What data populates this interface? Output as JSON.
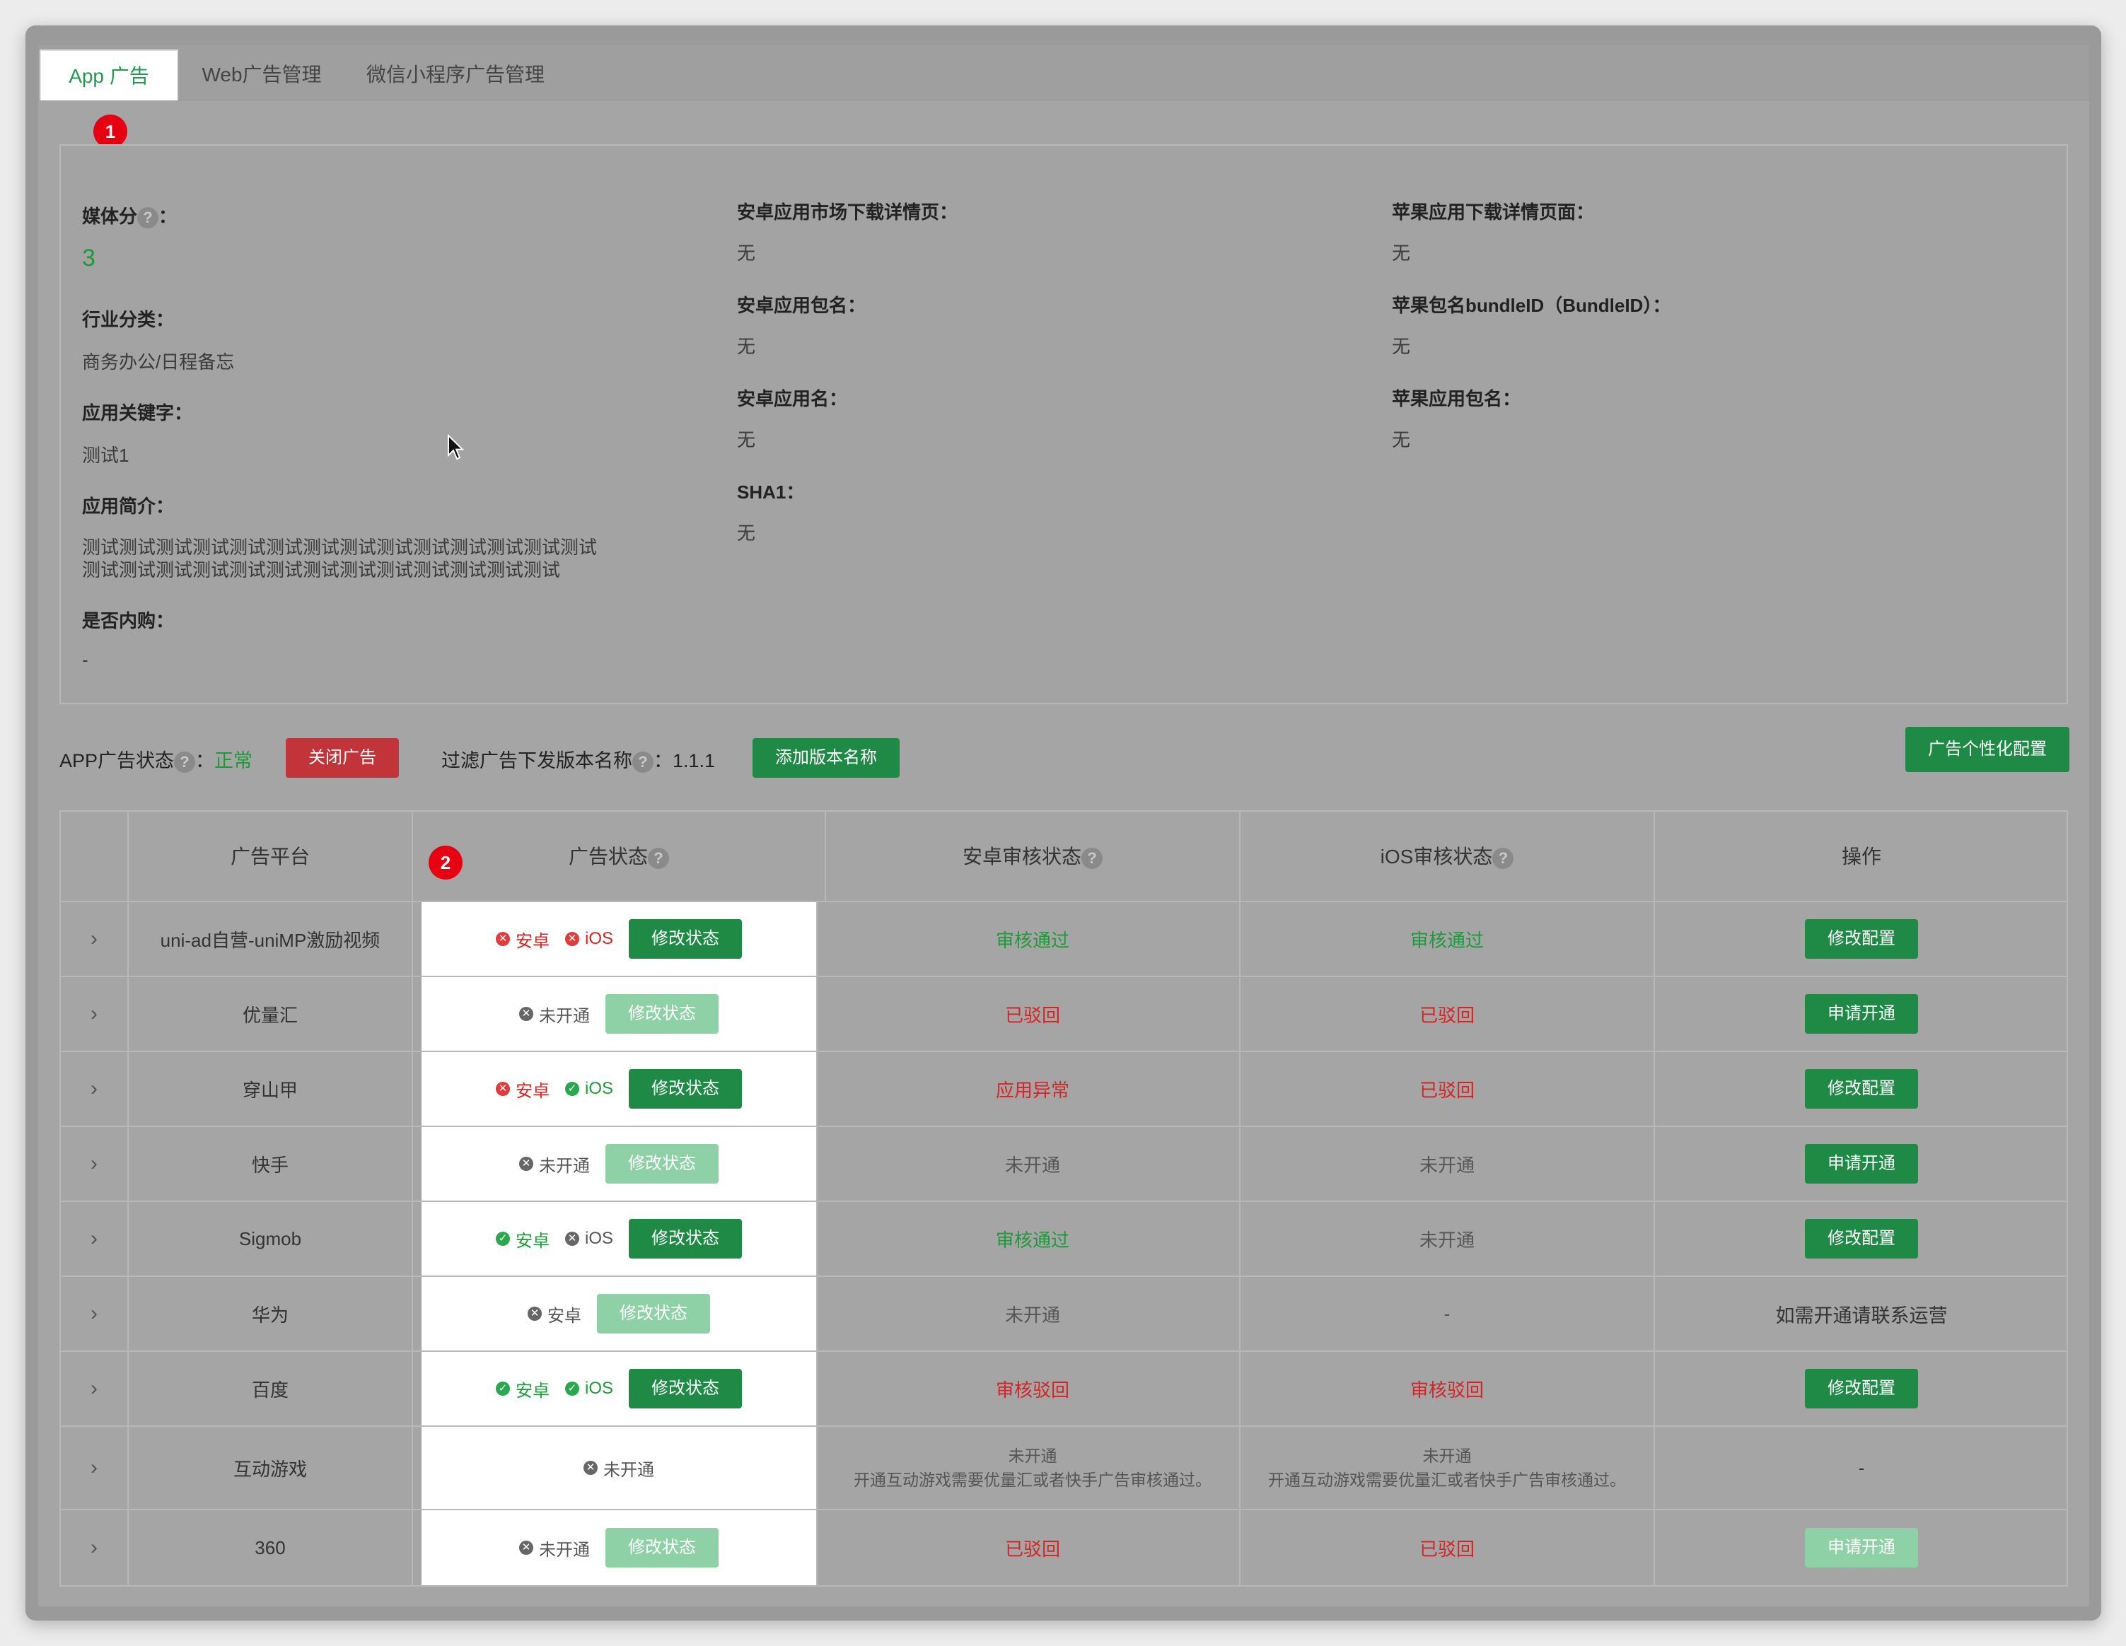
{
  "tabs": [
    {
      "label": "App 广告",
      "active": true
    },
    {
      "label": "Web广告管理",
      "active": false
    },
    {
      "label": "微信小程序广告管理",
      "active": false
    }
  ],
  "markers": {
    "one": "1",
    "two": "2"
  },
  "info": {
    "media_score_label": "媒体分",
    "colon": "：",
    "media_score_value": "3",
    "industry_label": "行业分类：",
    "industry_value": "商务办公/日程备忘",
    "keywords_label": "应用关键字：",
    "keywords_value": "测试1",
    "intro_label": "应用简介：",
    "intro_line1": "测试测试测试测试测试测试测试测试测试测试测试测试测试测试",
    "intro_line2": "测试测试测试测试测试测试测试测试测试测试测试测试测试",
    "iap_label": "是否内购：",
    "iap_value": "-",
    "android_market_label": "安卓应用市场下载详情页：",
    "android_market_value": "无",
    "android_pkg_label": "安卓应用包名：",
    "android_pkg_value": "无",
    "android_name_label": "安卓应用名：",
    "android_name_value": "无",
    "sha1_label": "SHA1：",
    "sha1_value": "无",
    "apple_download_label": "苹果应用下载详情页面：",
    "apple_download_value": "无",
    "apple_bundle_label": "苹果包名bundleID（BundleID）：",
    "apple_bundle_value": "无",
    "apple_pkg_label": "苹果应用包名：",
    "apple_pkg_value": "无"
  },
  "status_bar": {
    "app_status_label": "APP广告状态",
    "colon": "：",
    "app_status_value": "正常",
    "close_ad_button": "关闭广告",
    "filter_label": "过滤广告下发版本名称",
    "filter_value": "1.1.1",
    "add_version_button": "添加版本名称",
    "personalize_button": "广告个性化配置"
  },
  "table": {
    "headers": {
      "platform": "广告平台",
      "status": "广告状态",
      "android_review": "安卓审核状态",
      "ios_review": "iOS审核状态",
      "action": "操作"
    },
    "rows": [
      {
        "platform": "uni-ad自营-uniMP激励视频",
        "android": "安卓",
        "ios": "iOS",
        "status_btn": "修改状态",
        "android_review": "审核通过",
        "ios_review": "审核通过",
        "action": "修改配置"
      },
      {
        "platform": "优量汇",
        "closed": "未开通",
        "status_btn": "修改状态",
        "android_review": "已驳回",
        "ios_review": "已驳回",
        "action": "申请开通"
      },
      {
        "platform": "穿山甲",
        "android": "安卓",
        "ios": "iOS",
        "status_btn": "修改状态",
        "android_review": "应用异常",
        "ios_review": "已驳回",
        "action": "修改配置"
      },
      {
        "platform": "快手",
        "closed": "未开通",
        "status_btn": "修改状态",
        "android_review": "未开通",
        "ios_review": "未开通",
        "action": "申请开通"
      },
      {
        "platform": "Sigmob",
        "android": "安卓",
        "ios": "iOS",
        "status_btn": "修改状态",
        "android_review": "审核通过",
        "ios_review": "未开通",
        "action": "修改配置"
      },
      {
        "platform": "华为",
        "android": "安卓",
        "status_btn": "修改状态",
        "android_review": "未开通",
        "ios_review": "-",
        "action": "如需开通请联系运营"
      },
      {
        "platform": "百度",
        "android": "安卓",
        "ios": "iOS",
        "status_btn": "修改状态",
        "android_review": "审核驳回",
        "ios_review": "审核驳回",
        "action": "修改配置"
      },
      {
        "platform": "互动游戏",
        "closed": "未开通",
        "android_review": "未开通",
        "android_review_note": "开通互动游戏需要优量汇或者快手广告审核通过。",
        "ios_review": "未开通",
        "ios_review_note": "开通互动游戏需要优量汇或者快手广告审核通过。",
        "action": "-"
      },
      {
        "platform": "360",
        "closed": "未开通",
        "status_btn": "修改状态",
        "android_review": "已驳回",
        "ios_review": "已驳回",
        "action": "申请开通"
      }
    ]
  },
  "colors": {
    "accent": "#1f9a4e",
    "danger": "#c0343a",
    "marker": "#e60012"
  }
}
